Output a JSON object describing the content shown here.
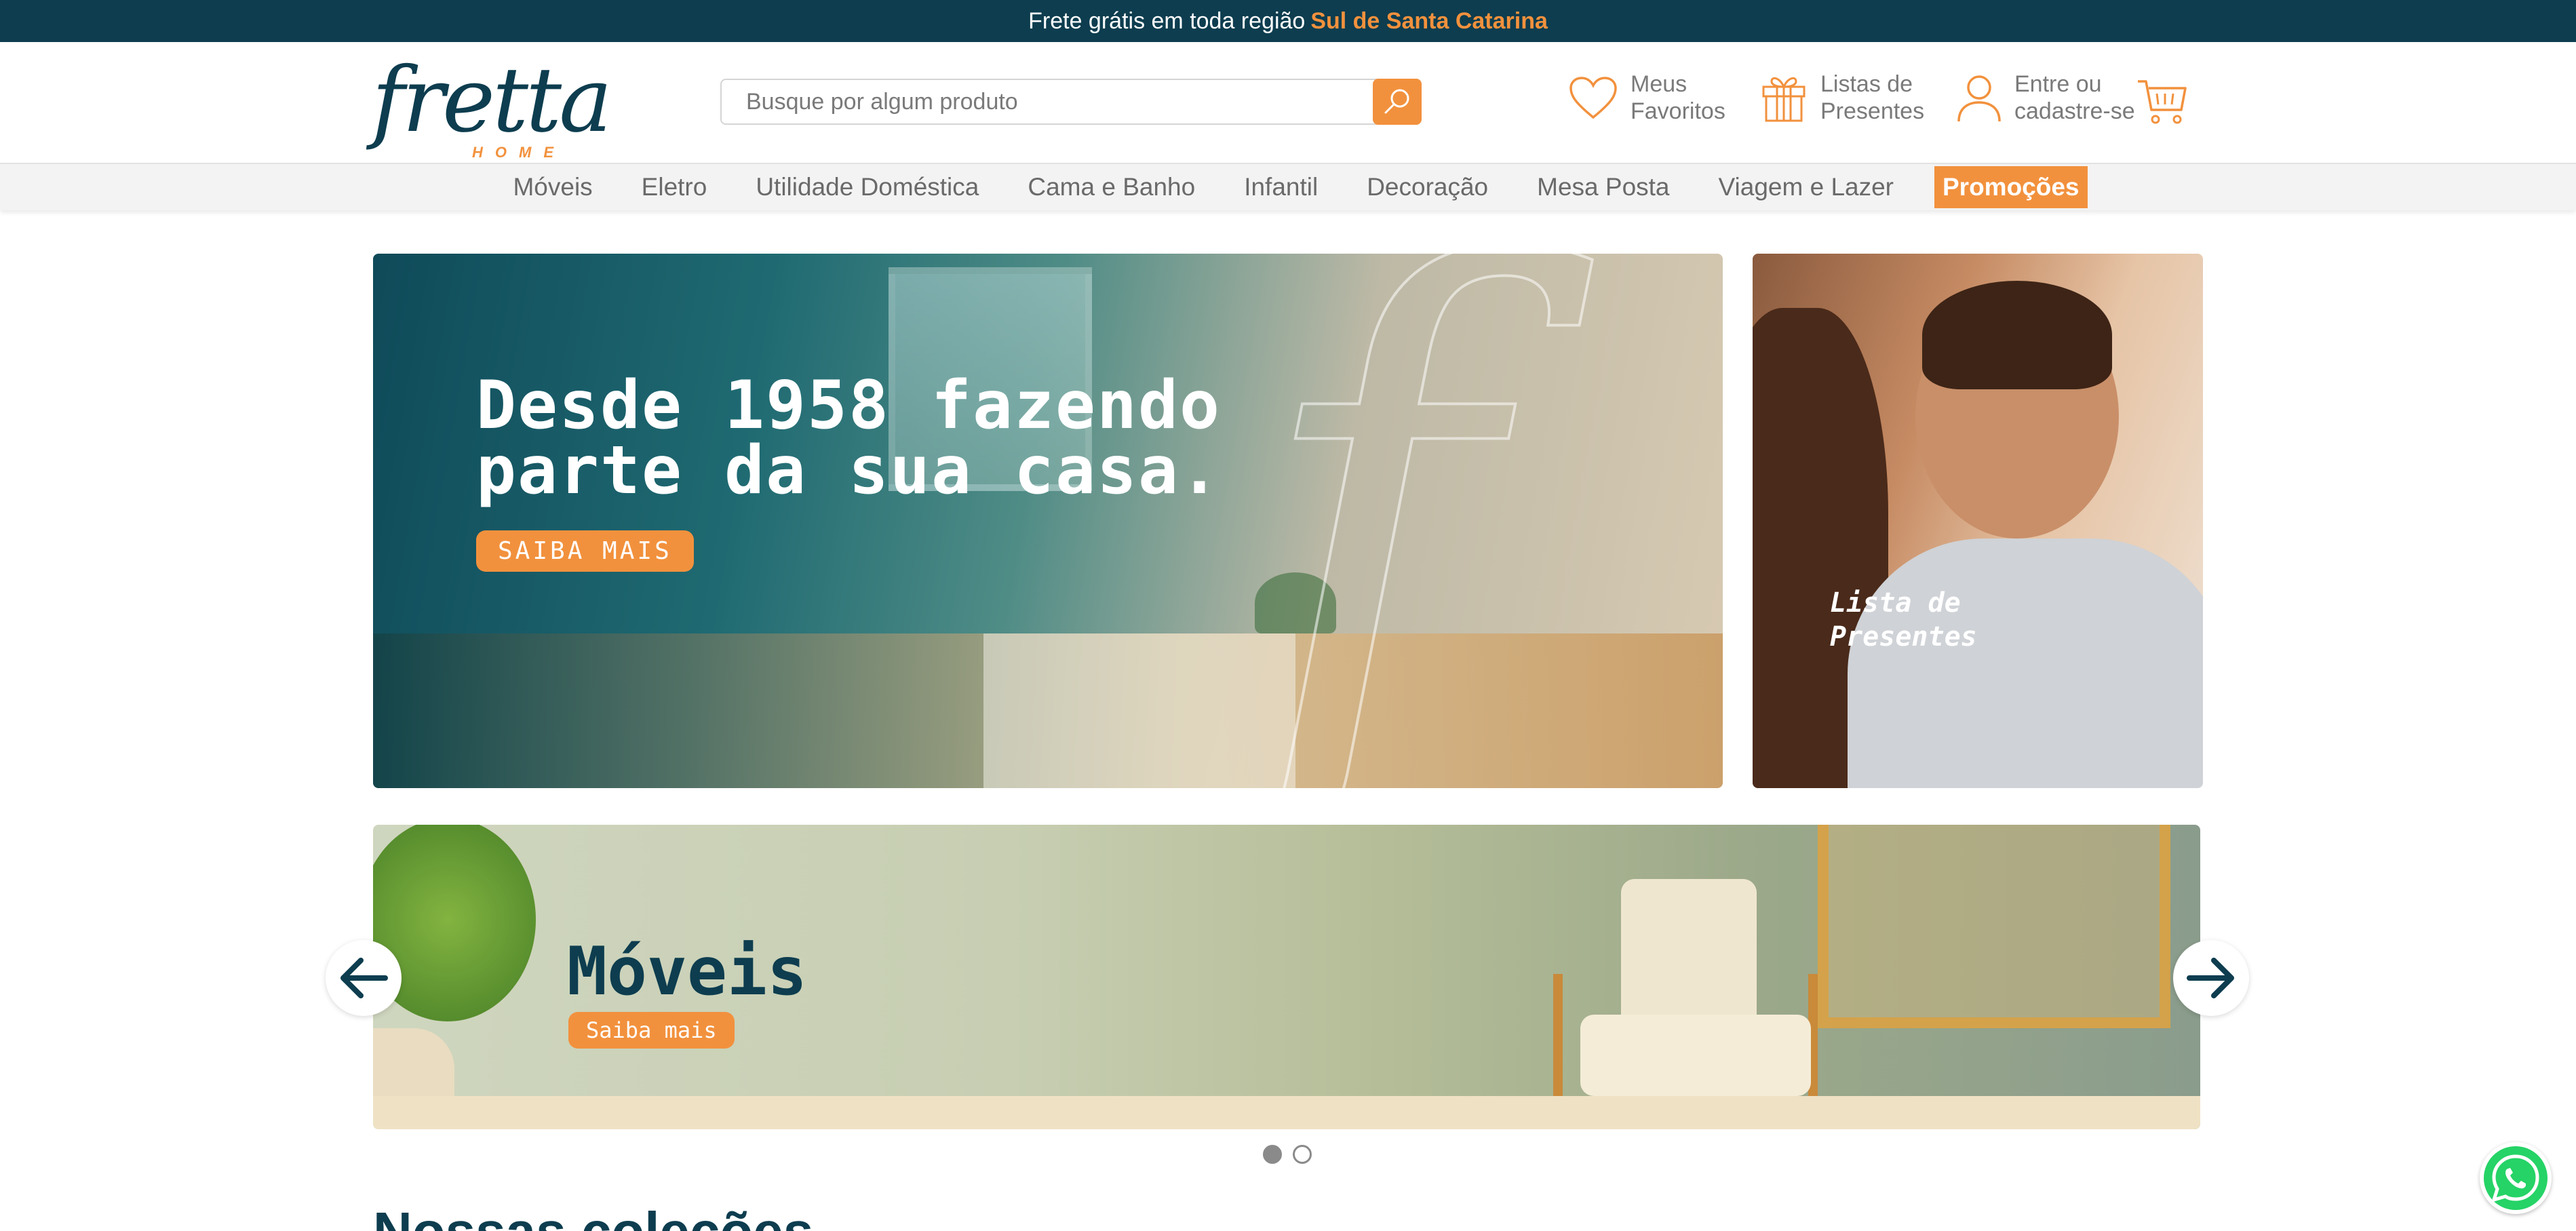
{
  "topbar": {
    "text": "Frete grátis em toda região",
    "highlight": "Sul de Santa Catarina"
  },
  "logo": {
    "word": "fretta",
    "sub": "HOME"
  },
  "search": {
    "placeholder": "Busque por algum produto",
    "button_icon": "search-icon"
  },
  "header_links": {
    "favorites": {
      "line1": "Meus",
      "line2": "Favoritos",
      "icon": "heart-icon"
    },
    "gifts": {
      "line1": "Listas de",
      "line2": "Presentes",
      "icon": "gift-icon"
    },
    "account": {
      "line1": "Entre ou",
      "line2": "cadastre-se",
      "icon": "user-icon"
    },
    "cart": {
      "icon": "cart-icon"
    }
  },
  "nav": {
    "items": [
      "Móveis",
      "Eletro",
      "Utilidade Doméstica",
      "Cama e Banho",
      "Infantil",
      "Decoração",
      "Mesa Posta",
      "Viagem e Lazer"
    ],
    "promo": "Promoções"
  },
  "banner_main": {
    "title": "Desde 1958 fazendo\nparte da sua casa.",
    "cta": "SAIBA MAIS"
  },
  "banner_side": {
    "label": "Lista de\nPresentes"
  },
  "carousel": {
    "title": "Móveis",
    "cta": "Saiba mais",
    "slides": 2,
    "active_slide": 1
  },
  "section": {
    "title": "Nossas coleções"
  },
  "colors": {
    "brand_dark": "#0d3d4f",
    "accent": "#f2913d",
    "whatsapp": "#25d366"
  }
}
